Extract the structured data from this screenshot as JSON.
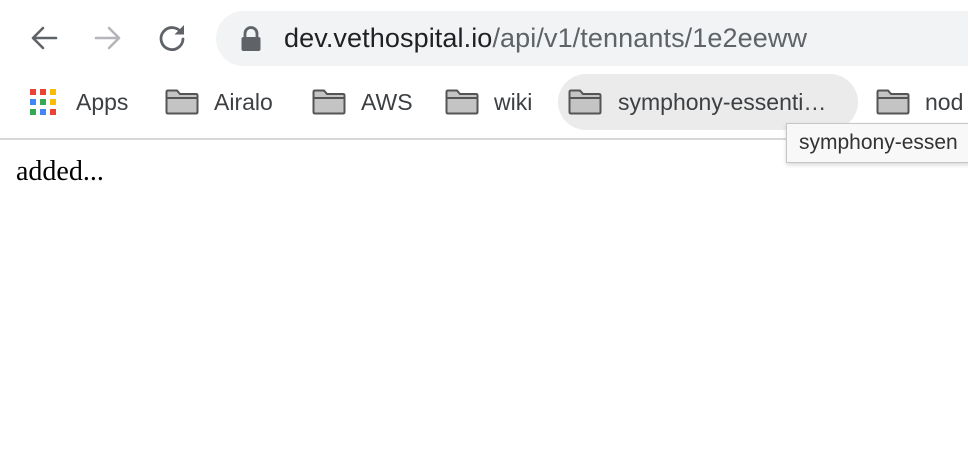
{
  "toolbar": {
    "back_icon": "arrow-left-icon",
    "forward_icon": "arrow-right-icon",
    "reload_icon": "reload-icon"
  },
  "omnibox": {
    "lock_icon": "lock-icon",
    "host": "dev.vethospital.io",
    "path": "/api/v1/tennants/1e2eeww"
  },
  "bookmarks": {
    "apps_label": "Apps",
    "items": [
      {
        "label": "Airalo",
        "icon": "folder-icon"
      },
      {
        "label": "AWS",
        "icon": "folder-icon"
      },
      {
        "label": "wiki",
        "icon": "folder-icon"
      },
      {
        "label": "symphony-essenti…",
        "icon": "folder-icon"
      },
      {
        "label": "nod",
        "icon": "folder-icon"
      }
    ],
    "tooltip": "symphony-essen"
  },
  "page": {
    "body_text": "added..."
  },
  "colors": {
    "omnibox_bg": "#f1f3f4",
    "hover_bg": "#ebebeb",
    "icon_gray": "#5f6368",
    "disabled_gray": "#b4b6b9"
  }
}
